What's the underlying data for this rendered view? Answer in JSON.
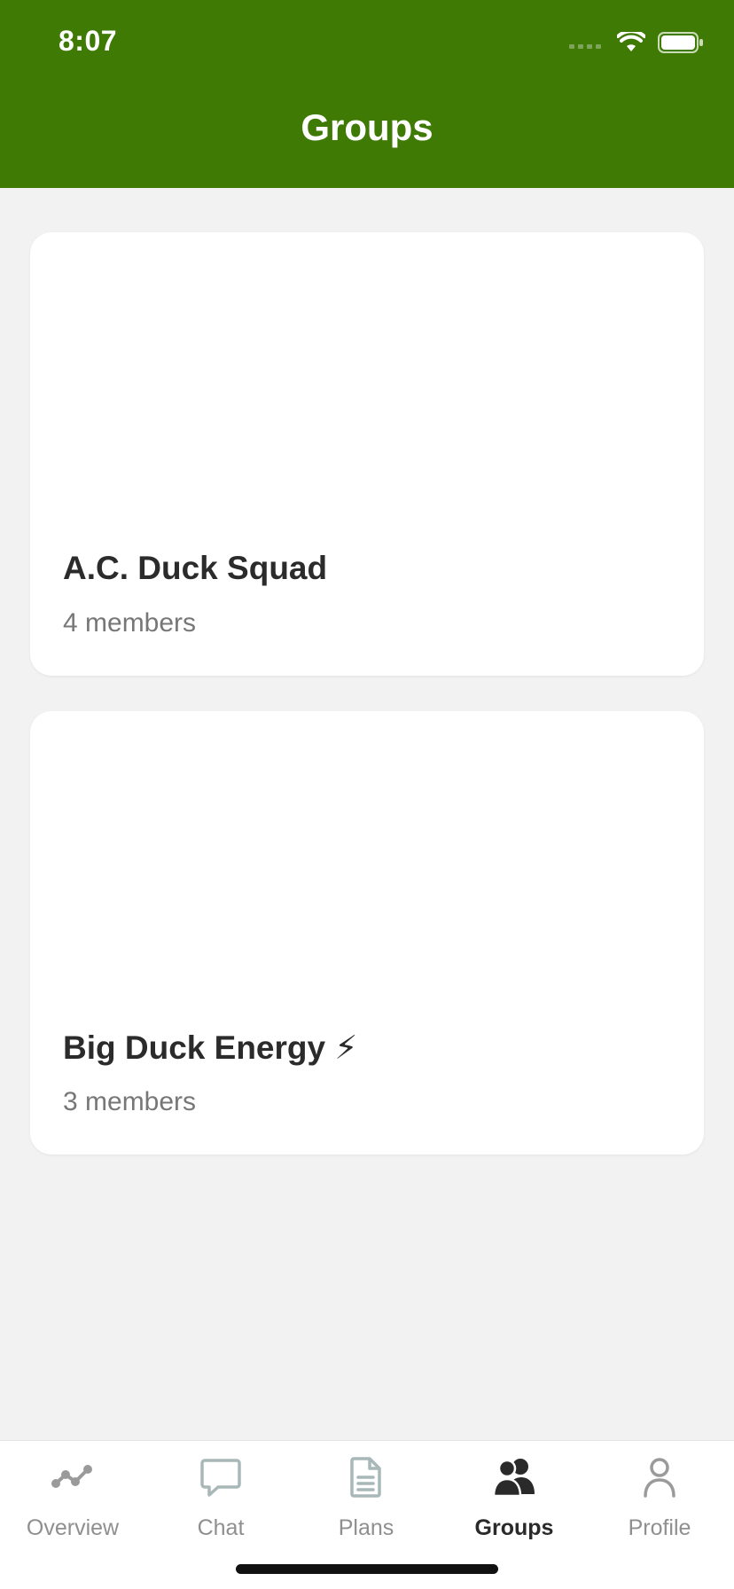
{
  "status_bar": {
    "time": "8:07"
  },
  "header": {
    "title": "Groups"
  },
  "groups": [
    {
      "name": "A.C. Duck Squad",
      "members": "4 members"
    },
    {
      "name": "Big Duck Energy ⚡",
      "members": "3 members"
    }
  ],
  "tabs": [
    {
      "label": "Overview",
      "icon": "overview-icon",
      "active": false
    },
    {
      "label": "Chat",
      "icon": "chat-icon",
      "active": false
    },
    {
      "label": "Plans",
      "icon": "document-icon",
      "active": false
    },
    {
      "label": "Groups",
      "icon": "people-icon",
      "active": true
    },
    {
      "label": "Profile",
      "icon": "person-icon",
      "active": false
    }
  ],
  "colors": {
    "header": "#3f7a05",
    "background": "#f2f2f2",
    "tab_inactive": "#8f8f8f",
    "tab_active": "#2a2a2a"
  }
}
